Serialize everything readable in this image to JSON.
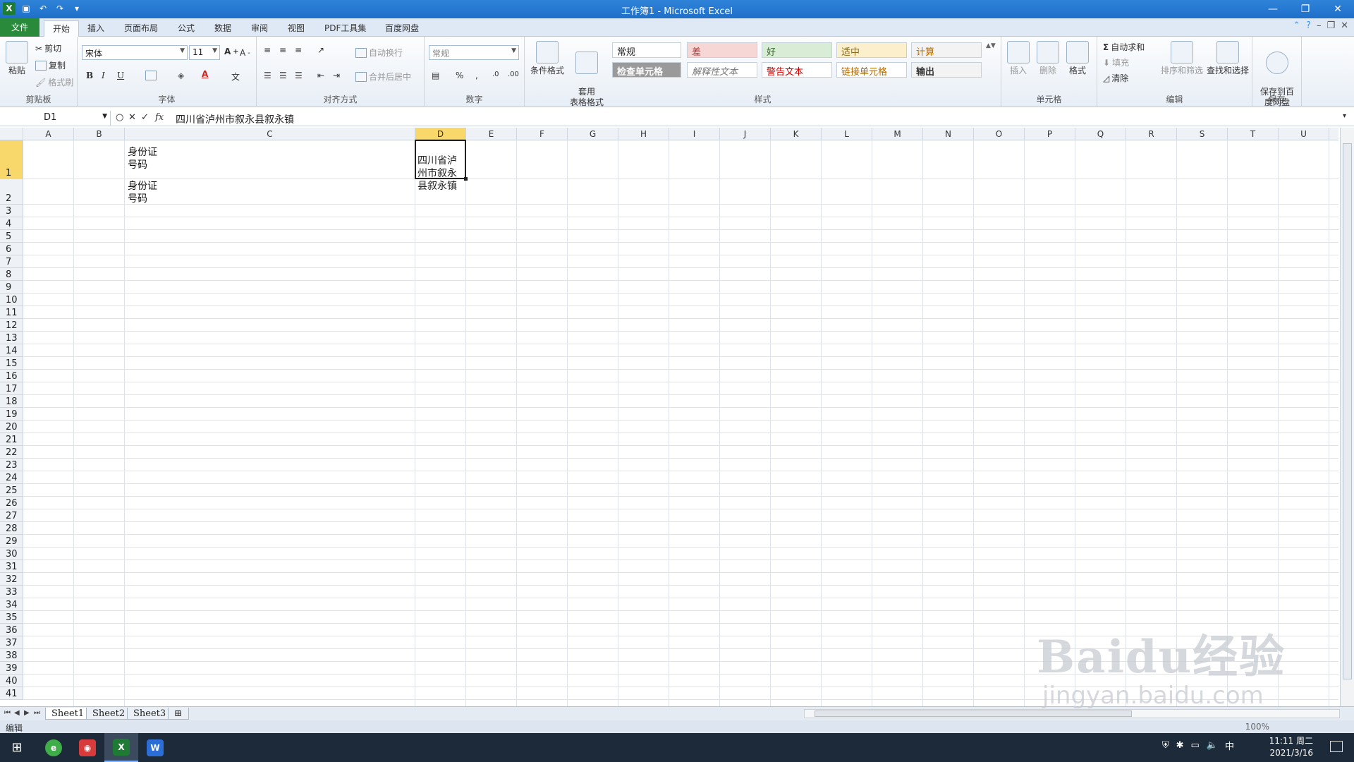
{
  "window": {
    "title": "工作簿1 - Microsoft Excel",
    "controls": [
      "—",
      "❐",
      "✕"
    ]
  },
  "ribbon_tabs": [
    "文件",
    "开始",
    "插入",
    "页面布局",
    "公式",
    "数据",
    "审阅",
    "视图",
    "PDF工具集",
    "百度网盘"
  ],
  "active_tab": "开始",
  "ribbon": {
    "clipboard": {
      "label": "剪贴板",
      "paste": "粘贴",
      "cut": "剪切",
      "copy": "复制",
      "format_painter": "格式刷"
    },
    "font": {
      "label": "字体",
      "name": "宋体",
      "size": "11",
      "bold": "B",
      "italic": "I",
      "underline": "U",
      "font_color_glyph": "A"
    },
    "alignment": {
      "label": "对齐方式",
      "wrap": "自动换行",
      "merge": "合并后居中"
    },
    "number": {
      "label": "数字",
      "format": "常规",
      "percent": "%",
      "comma": ","
    },
    "styles": {
      "label": "样式",
      "conditional": "条件格式",
      "table_format": "套用\n表格格式",
      "cells": [
        "常规",
        "差",
        "好",
        "适中",
        "计算",
        "检查单元格",
        "解释性文本",
        "警告文本",
        "链接单元格",
        "输出"
      ]
    },
    "cells": {
      "label": "单元格",
      "insert": "插入",
      "delete": "删除",
      "format": "格式"
    },
    "editing": {
      "label": "编辑",
      "autosum": "自动求和",
      "fill": "填充",
      "clear": "清除",
      "sort_filter": "排序和筛选",
      "find_select": "查找和选择"
    },
    "save": {
      "label": "保存",
      "save_to_baidu": "保存到百\n度网盘"
    }
  },
  "formula_bar": {
    "name_box": "D1",
    "fx": "fx",
    "content": "四川省泸州市叙永县叙永镇"
  },
  "columns": [
    "A",
    "B",
    "C",
    "D",
    "E",
    "F",
    "G",
    "H",
    "I",
    "J",
    "K",
    "L",
    "M",
    "N",
    "O",
    "P",
    "Q",
    "R",
    "S",
    "T",
    "U"
  ],
  "rows": [
    "1",
    "2",
    "3",
    "4",
    "5",
    "6",
    "7",
    "8",
    "9",
    "10",
    "11",
    "12",
    "13",
    "14",
    "15",
    "16",
    "17",
    "18",
    "19",
    "20",
    "21",
    "22",
    "23",
    "24",
    "25",
    "26",
    "27",
    "28",
    "29",
    "30",
    "31",
    "32",
    "33",
    "34",
    "35",
    "36",
    "37",
    "38",
    "39",
    "40",
    "41"
  ],
  "cells": {
    "C1": "身份证\n号码",
    "C2": "身份证\n号码",
    "D1": "四川省泸\n州市叙永\n县叙永镇"
  },
  "sheets": [
    "Sheet1",
    "Sheet2",
    "Sheet3"
  ],
  "active_sheet": "Sheet1",
  "status": {
    "mode": "编辑",
    "zoom": "100%"
  },
  "taskbar": {
    "time": "11:11 周二",
    "date": "2021/3/16",
    "ime": "中"
  },
  "watermark": {
    "line1": "Baidu经验",
    "line2": "jingyan.baidu.com"
  }
}
